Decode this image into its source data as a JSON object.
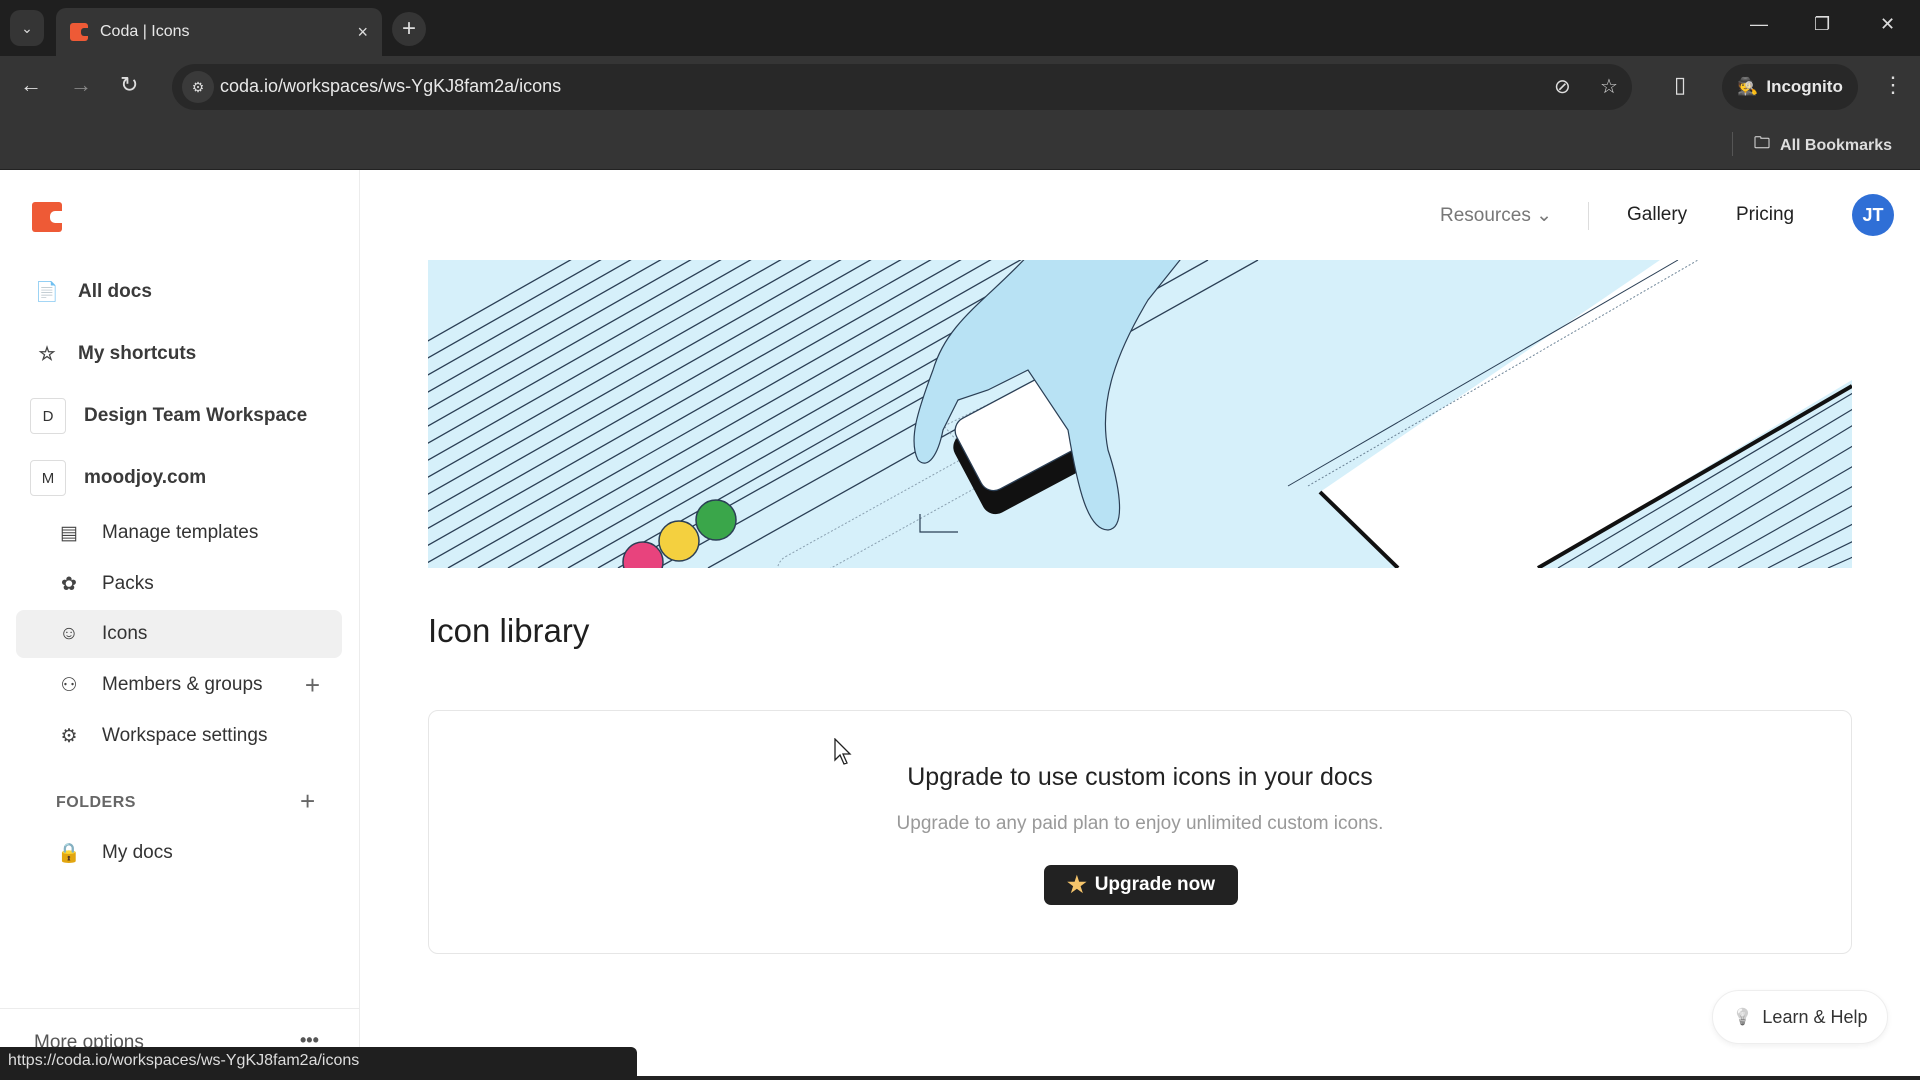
{
  "browser": {
    "tab_title": "Coda | Icons",
    "tab_close": "×",
    "new_tab": "+",
    "url": "coda.io/workspaces/ws-YgKJ8fam2a/icons",
    "incognito_label": "Incognito",
    "all_bookmarks": "All Bookmarks",
    "status_url": "https://coda.io/workspaces/ws-YgKJ8fam2a/icons",
    "icons": {
      "tab_dropdown": "⌄",
      "back": "←",
      "forward": "→",
      "reload": "↻",
      "site_info": "⚙",
      "eye_off": "⊘",
      "bookmark_star": "☆",
      "side_panel": "▯",
      "menu": "⋮",
      "minimize": "—",
      "restore": "❐",
      "close": "✕",
      "folder": "🗀"
    }
  },
  "sidebar": {
    "items": [
      {
        "label": "All docs",
        "icon": "📄"
      },
      {
        "label": "My shortcuts",
        "icon": "☆"
      },
      {
        "label": "Design Team Workspace",
        "badge": "D"
      },
      {
        "label": "moodjoy.com",
        "badge": "M"
      }
    ],
    "sub_items": [
      {
        "label": "Manage templates",
        "icon": "▤"
      },
      {
        "label": "Packs",
        "icon": "✿"
      },
      {
        "label": "Icons",
        "icon": "☺",
        "active": true
      },
      {
        "label": "Members & groups",
        "icon": "⚇",
        "plus": "+"
      },
      {
        "label": "Workspace settings",
        "icon": "⚙"
      }
    ],
    "folders_label": "FOLDERS",
    "folders_plus": "+",
    "folder_items": [
      {
        "label": "My docs",
        "icon": "🔒"
      }
    ],
    "more_options": "More options",
    "more_dots": "•••"
  },
  "topnav": {
    "resources": "Resources ⌄",
    "gallery": "Gallery",
    "pricing": "Pricing",
    "avatar_initials": "JT"
  },
  "main": {
    "title": "Icon library",
    "card": {
      "title": "Upgrade to use custom icons in your docs",
      "subtitle": "Upgrade to any paid plan to enjoy unlimited custom icons.",
      "button_label": "Upgrade now",
      "button_icon": "★"
    },
    "learn_help": "Learn & Help",
    "learn_help_icon": "💡"
  },
  "colors": {
    "brand": "#ee5a36",
    "avatar": "#2f6fd6",
    "hero_bg": "#d6f0fa",
    "button_bg": "#222222",
    "star": "#f6c56b"
  }
}
